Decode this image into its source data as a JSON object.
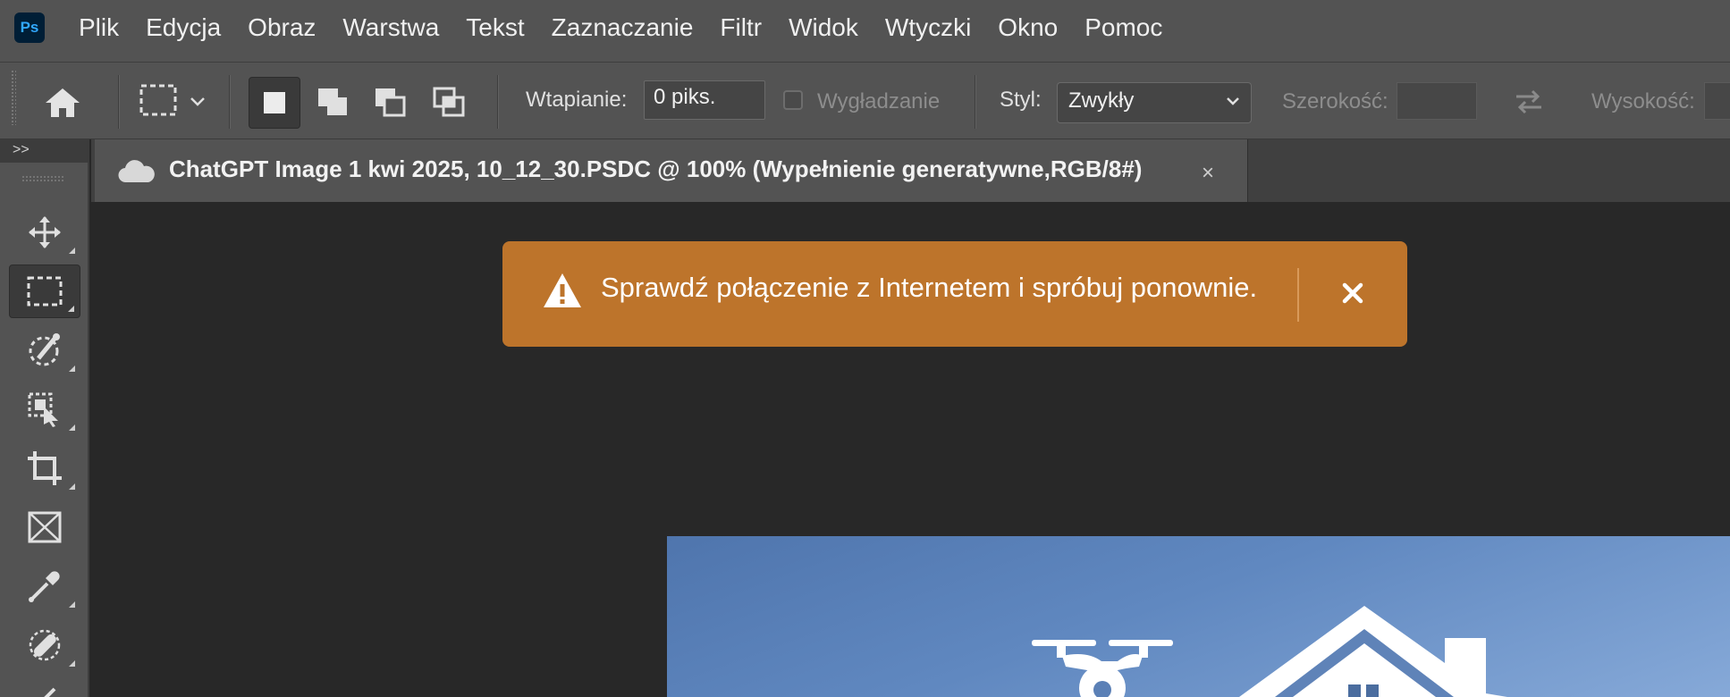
{
  "app": {
    "logo_text": "Ps",
    "accent": "#31a8ff"
  },
  "menu": {
    "items": [
      "Plik",
      "Edycja",
      "Obraz",
      "Warstwa",
      "Tekst",
      "Zaznaczanie",
      "Filtr",
      "Widok",
      "Wtyczki",
      "Okno",
      "Pomoc"
    ]
  },
  "options": {
    "feather_label": "Wtapianie:",
    "feather_value": "0 piks.",
    "antialias_label": "Wygładzanie",
    "antialias_checked": false,
    "style_label": "Styl:",
    "style_value": "Zwykły",
    "width_label": "Szerokość:",
    "height_label": "Wysokość:"
  },
  "tools_panel": {
    "collapse_glyph": ">>"
  },
  "document": {
    "tab_title": "ChatGPT Image 1 kwi 2025, 10_12_30.PSDC @ 100% (Wypełnienie generatywne,RGB/8#)",
    "close_glyph": "×"
  },
  "toast": {
    "message": "Sprawdź połączenie z Internetem i spróbuj ponownie.",
    "color": "#bd742b"
  },
  "icons": {
    "home": "home-icon",
    "marquee": "rect-marquee-icon",
    "tools": [
      "move-icon",
      "rect-marquee-icon",
      "quick-selection-icon",
      "object-selection-icon",
      "crop-icon",
      "frame-icon",
      "eyedropper-icon",
      "healing-brush-icon",
      "brush-icon"
    ]
  }
}
